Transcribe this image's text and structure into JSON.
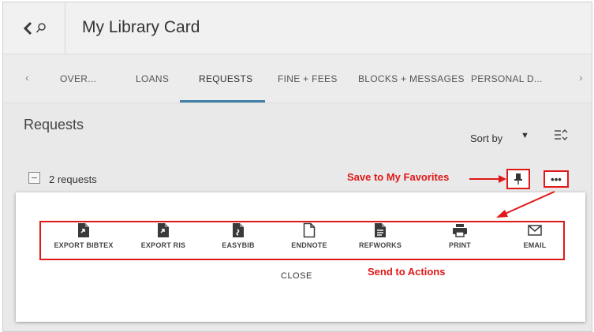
{
  "header": {
    "title": "My Library Card",
    "back_icon": "chevron-left-icon",
    "search_icon": "search-icon"
  },
  "tabs": [
    {
      "label": "OVER..."
    },
    {
      "label": "LOANS"
    },
    {
      "label": "REQUESTS",
      "active": true
    },
    {
      "label": "FINE + FEES"
    },
    {
      "label": "BLOCKS + MESSAGES"
    },
    {
      "label": "PERSONAL D..."
    }
  ],
  "section": {
    "title": "Requests",
    "sort_label": "Sort by"
  },
  "requests": {
    "count_label": "2 requests"
  },
  "actions": [
    {
      "label": "EXPORT BIBTEX",
      "icon": "export-bibtex-icon"
    },
    {
      "label": "EXPORT RIS",
      "icon": "export-ris-icon"
    },
    {
      "label": "EASYBIB",
      "icon": "easybib-icon"
    },
    {
      "label": "ENDNOTE",
      "icon": "endnote-icon"
    },
    {
      "label": "REFWORKS",
      "icon": "refworks-icon"
    },
    {
      "label": "PRINT",
      "icon": "print-icon"
    },
    {
      "label": "EMAIL",
      "icon": "email-icon"
    }
  ],
  "close_label": "CLOSE",
  "annotations": {
    "favorites": "Save to My Favorites",
    "send_to": "Send to Actions"
  },
  "colors": {
    "annotation": "#e01818",
    "active_tab": "#3f7fa6"
  }
}
